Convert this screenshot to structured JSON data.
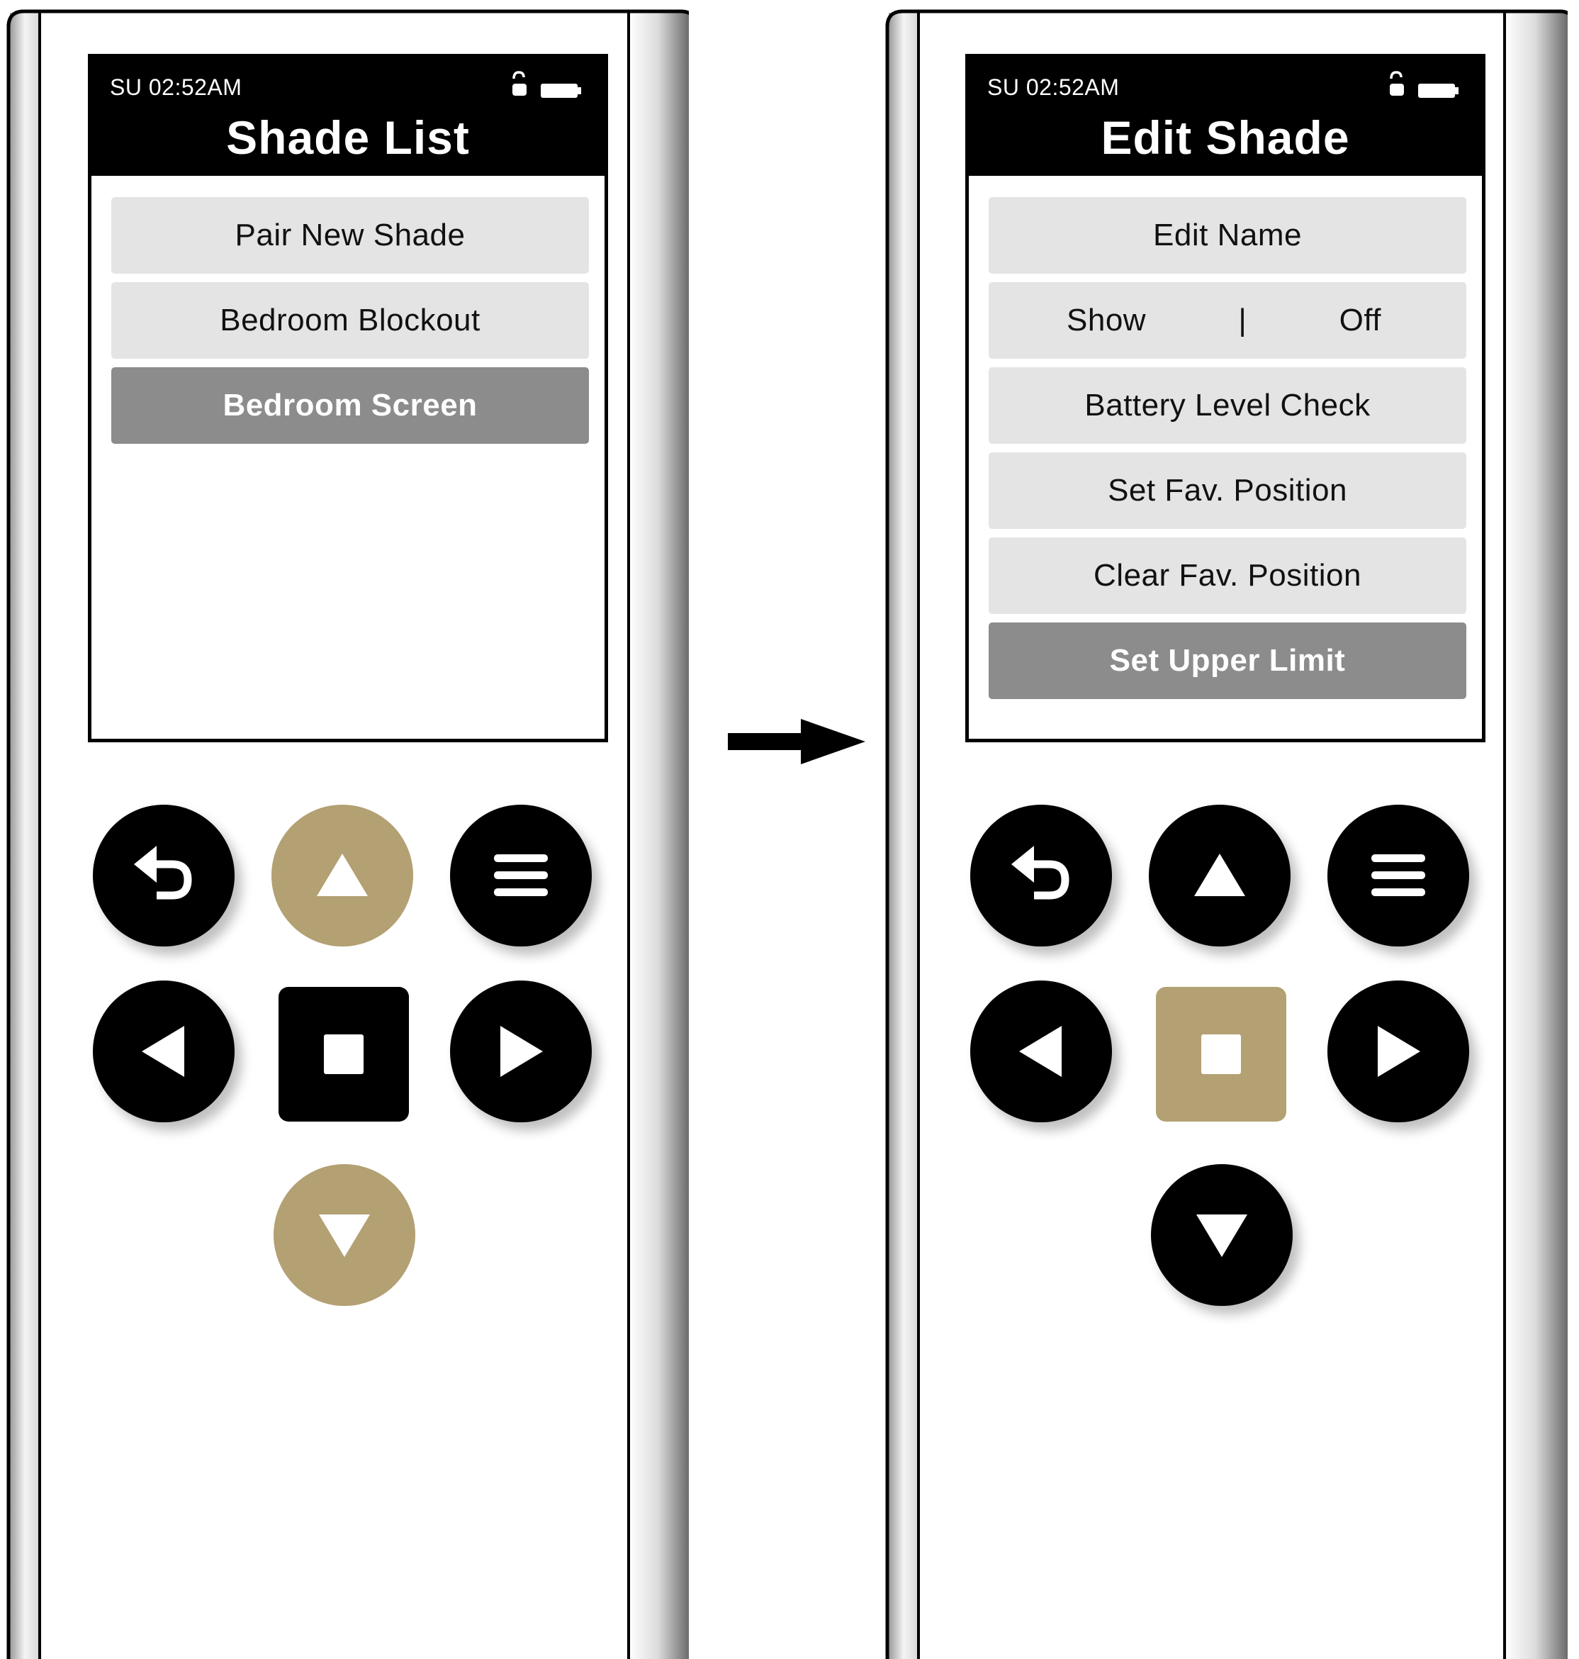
{
  "colors": {
    "accent_active": "#b3a073",
    "button": "#000000",
    "menu_item": "#e4e4e4",
    "menu_selected": "#8c8c8c"
  },
  "left_remote": {
    "status": {
      "time": "SU 02:52AM",
      "lock_icon": "unlock-icon",
      "battery_icon": "battery-icon"
    },
    "title": "Shade List",
    "menu": [
      {
        "label": "Pair New Shade",
        "selected": false
      },
      {
        "label": "Bedroom Blockout",
        "selected": false
      },
      {
        "label": "Bedroom Screen",
        "selected": true
      }
    ],
    "buttons": {
      "back": {
        "icon": "back-icon",
        "active": false
      },
      "up": {
        "icon": "up-arrow-icon",
        "active": true
      },
      "menu": {
        "icon": "menu-icon",
        "active": false
      },
      "left": {
        "icon": "left-arrow-icon",
        "active": false
      },
      "stop": {
        "icon": "stop-icon",
        "active": false
      },
      "right": {
        "icon": "right-arrow-icon",
        "active": false
      },
      "down": {
        "icon": "down-arrow-icon",
        "active": true
      }
    }
  },
  "right_remote": {
    "status": {
      "time": "SU 02:52AM",
      "lock_icon": "unlock-icon",
      "battery_icon": "battery-icon"
    },
    "title": "Edit Shade",
    "menu": {
      "edit_name": "Edit Name",
      "show_label": "Show",
      "show_sep": "|",
      "show_value": "Off",
      "battery_check": "Battery Level Check",
      "set_fav": "Set Fav. Position",
      "clear_fav": "Clear Fav. Position",
      "set_upper": "Set Upper Limit"
    },
    "selected_item": "Set Upper Limit",
    "buttons": {
      "back": {
        "icon": "back-icon",
        "active": false
      },
      "up": {
        "icon": "up-arrow-icon",
        "active": false
      },
      "menu": {
        "icon": "menu-icon",
        "active": false
      },
      "left": {
        "icon": "left-arrow-icon",
        "active": false
      },
      "stop": {
        "icon": "stop-icon",
        "active": true
      },
      "right": {
        "icon": "right-arrow-icon",
        "active": false
      },
      "down": {
        "icon": "down-arrow-icon",
        "active": false
      }
    }
  },
  "transition": {
    "icon": "right-arrow-icon"
  }
}
